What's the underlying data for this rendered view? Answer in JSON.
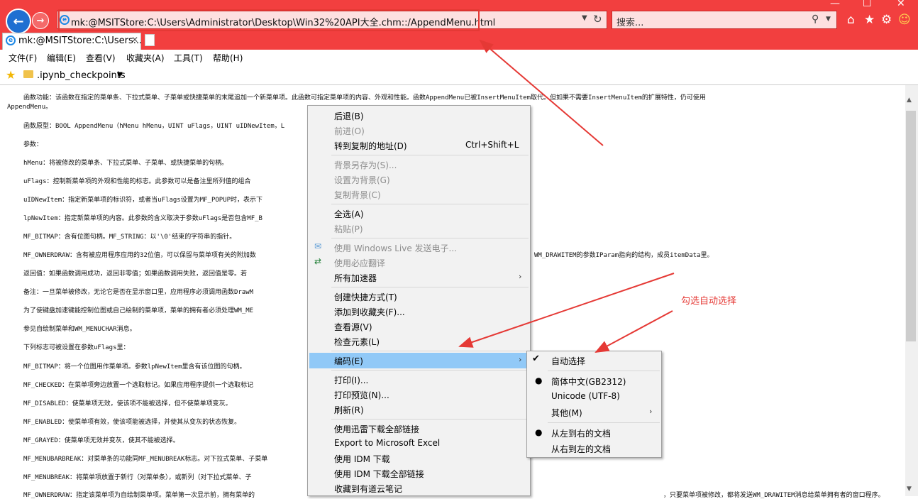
{
  "browser": {
    "address": "mk:@MSITStore:C:\\Users\\Administrator\\Desktop\\Win32%20API大全.chm::/AppendMenu.html",
    "search_placeholder": "搜索...",
    "tab_title": "mk:@MSITStore:C:\\Users..."
  },
  "menubar": [
    "文件(F)",
    "编辑(E)",
    "查看(V)",
    "收藏夹(A)",
    "工具(T)",
    "帮助(H)"
  ],
  "favorites": {
    "folder": ".ipynb_checkpoints"
  },
  "content_lines": [
    "函数功能：该函数在指定的菜单条、下拉式菜单、子菜单或快捷菜单的末尾追加一个新菜单项。此函数可指定菜单项的内容、外观和性能。函数AppendMenu已被InsertMenuItem取代。但如果不需要InsertMenuItem的扩展特性，仍可使用",
    "AppendMenu。",
    "函数原型：BOOL AppendMenu（hMenu hMenu，UINT uFlags，UINT uIDNewItem，L",
    "参数：",
    "hMenu：将被修改的菜单条、下拉式菜单、子菜单、或快捷菜单的句柄。",
    "uFlags：控制新菜单项的外观和性能的标志。此参数可以是备注里所列值的组合",
    "uIDNewItem：指定新菜单项的标识符，或者当uFlags设置为MF_POPUP时，表示下",
    "lpNewItem：指定新菜单项的内容。此参数的含义取决于参数uFlags是否包含MF_B",
    "MF_BITMAP：含有位图句柄。MF_STRING：以'\\0'结束的字符串的指针。",
    "MF_OWNERDRAW：含有被应用程序应用的32位值，可以保留与菜单项有关的附加数",
    "WM_DRAWITEM的参数IParam指向的结构，成员itemData里。",
    "返回值：如果函数调用成功，返回非零值；如果函数调用失败，返回值是零。若",
    "备注：一旦菜单被修改，无论它是否在显示窗口里，应用程序必须调用函数DrawM",
    "为了使键盘加速键能控制位图或自己绘制的菜单项，菜单的拥有者必须处理WM_ME",
    "参见自绘制菜单和WM_MENUCHAR消息。",
    "下列标志可被设置在参数uFlags里：",
    "MF_BITMAP：将一个位图用作菜单项。参数lpNewItem里含有该位图的句柄。",
    "MF_CHECKED：在菜单项旁边放置一个选取标记。如果应用程序提供一个选取标记",
    "MF_DISABLED：使菜单项无效，使该项不能被选择，但不使菜单项变灰。",
    "MF_ENABLED：使菜单项有效，使该项能被选择，并使其从变灰的状态恢复。",
    "MF_GRAYED：使菜单项无效并变灰，使其不能被选择。",
    "MF_MENUBARBREAK：对菜单条的功能同MF_MENUBREAK标志。对下拉式菜单、子菜单",
    "MF_MENUBREAK：将菜单项放置于新行（对菜单条），或新列（对下拉式菜单、子",
    "MF_OWNERDRAW：指定该菜单项为自绘制菜单项。菜单第一次显示前，拥有菜单的",
    "，只要菜单项被修改，都将发送WM_DRAWITEM消息给菜单拥有者的窗口程序。"
  ],
  "context_menu": {
    "back": "后退(B)",
    "forward": "前进(O)",
    "goto_copied": "转到复制的地址(D)",
    "goto_copied_shortcut": "Ctrl+Shift+L",
    "save_bg": "背景另存为(S)...",
    "set_bg": "设置为背景(G)",
    "copy_bg": "复制背景(C)",
    "select_all": "全选(A)",
    "paste": "粘贴(P)",
    "live_mail": "使用 Windows Live 发送电子...",
    "bing_translate": "使用必应翻译",
    "accelerators": "所有加速器",
    "create_shortcut": "创建快捷方式(T)",
    "add_favorites": "添加到收藏夹(F)...",
    "view_source": "查看源(V)",
    "inspect": "检查元素(L)",
    "encoding": "编码(E)",
    "print": "打印(I)...",
    "print_preview": "打印预览(N)...",
    "refresh": "刷新(R)",
    "xunlei": "使用迅雷下载全部链接",
    "export_excel": "Export to Microsoft Excel",
    "idm": "使用 IDM 下载",
    "idm_all": "使用 IDM 下载全部链接",
    "youdao": "收藏到有道云笔记"
  },
  "encoding_submenu": {
    "auto": "自动选择",
    "gb2312": "简体中文(GB2312)",
    "utf8": "Unicode (UTF-8)",
    "other": "其他(M)",
    "ltr": "从左到右的文档",
    "rtl": "从右到左的文档"
  },
  "annotation": "勾选自动选择",
  "colors": {
    "titlebar": "#f23f3f",
    "highlight": "#91c9f7",
    "annotation": "#e53935"
  }
}
